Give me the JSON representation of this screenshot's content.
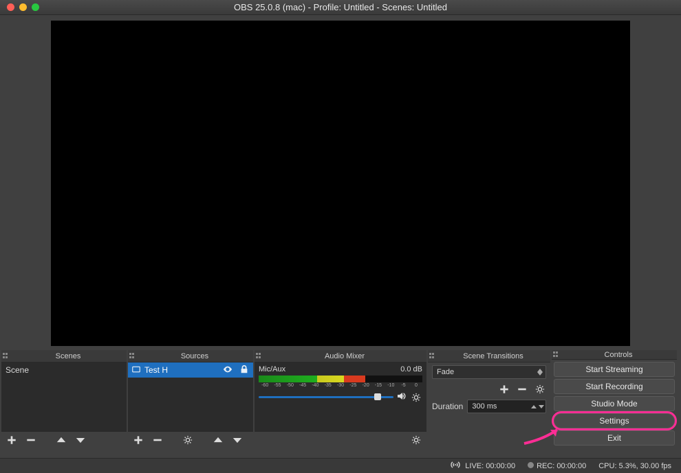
{
  "window": {
    "title": "OBS 25.0.8 (mac) - Profile: Untitled - Scenes: Untitled"
  },
  "docks": {
    "scenes": {
      "title": "Scenes",
      "items": [
        "Scene"
      ]
    },
    "sources": {
      "title": "Sources",
      "items": [
        {
          "name": "Test H",
          "visible": true,
          "locked": true
        }
      ]
    },
    "mixer": {
      "title": "Audio Mixer",
      "channels": [
        {
          "name": "Mic/Aux",
          "db": "0.0 dB"
        }
      ],
      "ticks": [
        "-60",
        "-55",
        "-50",
        "-45",
        "-40",
        "-35",
        "-30",
        "-25",
        "-20",
        "-15",
        "-10",
        "-5",
        "0"
      ]
    },
    "transitions": {
      "title": "Scene Transitions",
      "current": "Fade",
      "duration_label": "Duration",
      "duration_value": "300 ms"
    },
    "controls": {
      "title": "Controls",
      "buttons": {
        "start_streaming": "Start Streaming",
        "start_recording": "Start Recording",
        "studio_mode": "Studio Mode",
        "settings": "Settings",
        "exit": "Exit"
      }
    }
  },
  "status": {
    "live": "LIVE: 00:00:00",
    "rec": "REC: 00:00:00",
    "cpu": "CPU: 5.3%, 30.00 fps"
  }
}
